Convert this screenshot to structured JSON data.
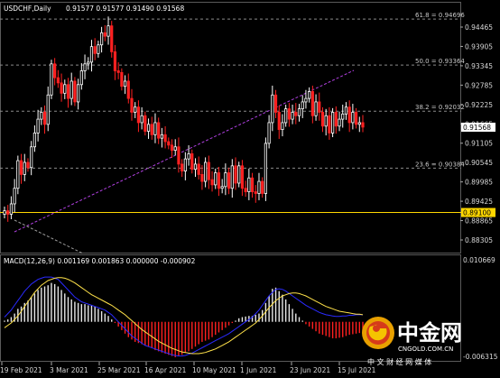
{
  "header": {
    "symbol": "USDCHF,Daily",
    "ohlc": "0.91577 0.91577 0.91490 0.91568",
    "macd_label": "MACD(12,26,9) 0.001169 0.001863 0.000000 -0.000902"
  },
  "fibo_labels": [
    {
      "text": "61.8 = 0.94696",
      "price": 0.94696
    },
    {
      "text": "50.0 = 0.93364",
      "price": 0.93364
    },
    {
      "text": "38.2 = 0.92032",
      "price": 0.92032
    },
    {
      "text": "23.6 = 0.90384",
      "price": 0.90384
    }
  ],
  "price_axis": [
    "0.94465",
    "0.93905",
    "0.93345",
    "0.92785",
    "0.92225",
    "0.91665",
    "0.91105",
    "0.90545",
    "0.89985",
    "0.89425",
    "0.88865",
    "0.88305"
  ],
  "price_axis_values": [
    0.94465,
    0.93905,
    0.93345,
    0.92785,
    0.92225,
    0.91665,
    0.91105,
    0.90545,
    0.89985,
    0.89425,
    0.88865,
    0.88305
  ],
  "current_price": {
    "text": "0.91568",
    "value": 0.91568
  },
  "level_line": {
    "text": "0.89100",
    "value": 0.891
  },
  "macd_axis": {
    "top": "0.010669",
    "bottom": "-0.006315",
    "top_value": 0.010669,
    "bottom_value": -0.006315
  },
  "date_axis": [
    "19 Feb 2021",
    "3 Mar 2021",
    "25 Mar 2021",
    "16 Apr 2021",
    "10 May 2021",
    "1 Jun 2021",
    "23 Jun 2021",
    "15 Jul 2021"
  ],
  "watermark": {
    "title": "中金网",
    "subtitle": "中 文 财 经 网 媒 体",
    "url": "CNGOLD.COM.CN"
  },
  "colors": {
    "background": "#000000",
    "bull": "#ffffff",
    "bear": "#ff2020",
    "level": "#ffd700",
    "trend": "#b040e0",
    "macd_signal": "#ffe24a",
    "macd_line": "#2a2aff",
    "grid": "#606060"
  },
  "chart_data": {
    "type": "candlestick",
    "close": [
      0.8915,
      0.8905,
      0.8935,
      0.898,
      0.906,
      0.902,
      0.9055,
      0.904,
      0.91,
      0.914,
      0.918,
      0.92,
      0.9165,
      0.925,
      0.934,
      0.93,
      0.9285,
      0.9255,
      0.928,
      0.924,
      0.929,
      0.923,
      0.928,
      0.932,
      0.934,
      0.9345,
      0.939,
      0.937,
      0.9395,
      0.943,
      0.942,
      0.945,
      0.9375,
      0.932,
      0.9315,
      0.9275,
      0.929,
      0.924,
      0.92,
      0.9215,
      0.917,
      0.919,
      0.9145,
      0.9165,
      0.9135,
      0.917,
      0.9125,
      0.9135,
      0.9115,
      0.9105,
      0.909,
      0.91,
      0.905,
      0.903,
      0.9065,
      0.908,
      0.9035,
      0.905,
      0.902,
      0.9,
      0.9055,
      0.9005,
      0.899,
      0.9025,
      0.898,
      0.8985,
      0.9025,
      0.898,
      0.9045,
      0.8995,
      0.9045,
      0.898,
      0.897,
      0.901,
      0.897,
      0.8965,
      0.9,
      0.8965,
      0.911,
      0.917,
      0.925,
      0.92,
      0.915,
      0.917,
      0.921,
      0.918,
      0.92,
      0.919,
      0.921,
      0.923,
      0.924,
      0.926,
      0.919,
      0.923,
      0.92,
      0.916,
      0.919,
      0.914,
      0.92,
      0.916,
      0.918,
      0.9195,
      0.9215,
      0.917,
      0.92,
      0.9165,
      0.917,
      0.9157
    ],
    "macd_hist": [
      0.0002,
      0.0004,
      0.0008,
      0.0014,
      0.0022,
      0.0026,
      0.0032,
      0.0036,
      0.0042,
      0.0048,
      0.0054,
      0.0058,
      0.006,
      0.0062,
      0.0066,
      0.0064,
      0.006,
      0.0054,
      0.0048,
      0.0042,
      0.0038,
      0.0034,
      0.0032,
      0.003,
      0.003,
      0.0028,
      0.0028,
      0.0026,
      0.0022,
      0.0018,
      0.0014,
      0.001,
      0.0004,
      -0.0002,
      -0.0008,
      -0.0014,
      -0.002,
      -0.0026,
      -0.003,
      -0.0034,
      -0.0036,
      -0.0038,
      -0.004,
      -0.0042,
      -0.0044,
      -0.0048,
      -0.005,
      -0.0052,
      -0.0054,
      -0.0056,
      -0.0058,
      -0.006,
      -0.0058,
      -0.0056,
      -0.0052,
      -0.005,
      -0.0046,
      -0.0042,
      -0.0038,
      -0.0034,
      -0.0032,
      -0.003,
      -0.0026,
      -0.0022,
      -0.0018,
      -0.0014,
      -0.001,
      -0.0006,
      -0.0002,
      0.0002,
      0.0006,
      0.0008,
      0.0009,
      0.001,
      0.001,
      0.0012,
      0.0014,
      0.002,
      0.0032,
      0.0044,
      0.0056,
      0.0058,
      0.0052,
      0.0046,
      0.0038,
      0.003,
      0.0022,
      0.0014,
      0.0008,
      0.0002,
      -0.0004,
      -0.0008,
      -0.0012,
      -0.0016,
      -0.002,
      -0.0022,
      -0.0024,
      -0.0026,
      -0.0028,
      -0.0028,
      -0.0027,
      -0.0026,
      -0.0024,
      -0.0022,
      -0.0021,
      -0.002,
      -0.0019,
      -0.0018
    ],
    "series": [
      {
        "name": "MACD",
        "values": [
          0.0008,
          0.0014,
          0.002,
          0.0028,
          0.0036,
          0.0044,
          0.0052,
          0.0058,
          0.0064,
          0.0068,
          0.0072,
          0.0074,
          0.0076,
          0.0076,
          0.0076,
          0.0074,
          0.0072,
          0.0066,
          0.006,
          0.0054,
          0.0048,
          0.0042,
          0.0038,
          0.0034,
          0.0032,
          0.003,
          0.0028,
          0.0026,
          0.0024,
          0.0022,
          0.002,
          0.0016,
          0.0012,
          0.0006,
          0.0,
          -0.0006,
          -0.0012,
          -0.0018,
          -0.0024,
          -0.0028,
          -0.0032,
          -0.0036,
          -0.004,
          -0.0042,
          -0.0044,
          -0.0046,
          -0.0048,
          -0.005,
          -0.0052,
          -0.0054,
          -0.0056,
          -0.0057,
          -0.0058,
          -0.0058,
          -0.0057,
          -0.0055,
          -0.0053,
          -0.005,
          -0.0047,
          -0.0044,
          -0.0041,
          -0.0038,
          -0.0035,
          -0.0032,
          -0.0029,
          -0.0026,
          -0.0023,
          -0.002,
          -0.0016,
          -0.0012,
          -0.0008,
          -0.0004,
          0.0,
          0.0004,
          0.0008,
          0.0014,
          0.002,
          0.0028,
          0.0036,
          0.0044,
          0.005,
          0.0055,
          0.0056,
          0.0055,
          0.0052,
          0.0048,
          0.0044,
          0.004,
          0.0036,
          0.0032,
          0.0028,
          0.0025,
          0.0022,
          0.0019,
          0.0016,
          0.0014,
          0.0012,
          0.0011,
          0.001,
          0.0009,
          0.0009,
          0.001,
          0.001,
          0.0011,
          0.0011,
          0.0012,
          0.0012,
          0.0012
        ]
      },
      {
        "name": "Signal",
        "values": [
          -0.001,
          -0.0006,
          -0.0002,
          0.0004,
          0.001,
          0.0018,
          0.0026,
          0.0034,
          0.0042,
          0.005,
          0.0056,
          0.0062,
          0.0066,
          0.007,
          0.0072,
          0.0074,
          0.0075,
          0.0075,
          0.0074,
          0.0072,
          0.0069,
          0.0066,
          0.0062,
          0.0058,
          0.0054,
          0.005,
          0.0046,
          0.0043,
          0.004,
          0.0037,
          0.0034,
          0.0031,
          0.0028,
          0.0024,
          0.002,
          0.0016,
          0.0012,
          0.0007,
          0.0002,
          -0.0003,
          -0.0008,
          -0.0013,
          -0.0017,
          -0.0021,
          -0.0025,
          -0.0029,
          -0.0033,
          -0.0036,
          -0.0039,
          -0.0042,
          -0.0045,
          -0.0047,
          -0.0049,
          -0.0051,
          -0.0052,
          -0.0053,
          -0.0054,
          -0.0054,
          -0.0054,
          -0.0053,
          -0.0052,
          -0.005,
          -0.0048,
          -0.0046,
          -0.0043,
          -0.004,
          -0.0037,
          -0.0034,
          -0.003,
          -0.0026,
          -0.0022,
          -0.0018,
          -0.0014,
          -0.001,
          -0.0006,
          -0.0002,
          0.0004,
          0.001,
          0.0017,
          0.0024,
          0.003,
          0.0036,
          0.004,
          0.0044,
          0.0046,
          0.0048,
          0.0049,
          0.0049,
          0.0048,
          0.0046,
          0.0044,
          0.0041,
          0.0038,
          0.0035,
          0.0032,
          0.0029,
          0.0026,
          0.0024,
          0.0022,
          0.002,
          0.0018,
          0.0017,
          0.0016,
          0.0015,
          0.0014,
          0.0013,
          0.0013,
          0.0012
        ]
      }
    ]
  }
}
